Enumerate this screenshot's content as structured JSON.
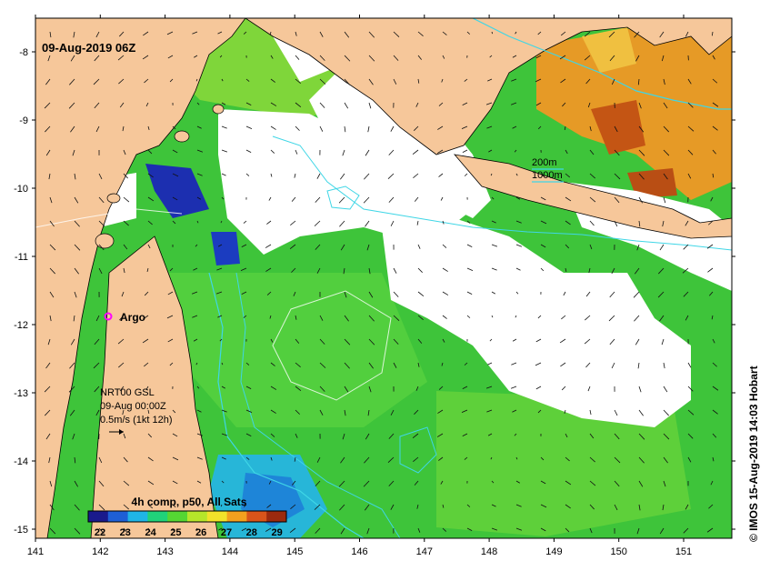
{
  "title": "09-Aug-2019 06Z",
  "argo_label": "Argo",
  "tide_gauge": {
    "line1": "NRT00 GSL",
    "line2": "09-Aug 00:00Z",
    "line3": "0.5m/s (1kt 12h)"
  },
  "isobaths": {
    "shallow": "200m",
    "deep": "1000m"
  },
  "colorbar": {
    "title": "4h comp, p50, All Sats",
    "ticks": [
      "22",
      "23",
      "24",
      "25",
      "26",
      "27",
      "28",
      "29"
    ],
    "colors": [
      "#1a1a8c",
      "#1e5fd6",
      "#1fb5e6",
      "#20d27a",
      "#55d633",
      "#b6e62a",
      "#f2e22a",
      "#f3a01e",
      "#d9541a",
      "#9c2a0e"
    ]
  },
  "credit": "© IMOS 15-Aug-2019 14:03 Hobart",
  "axes": {
    "x_ticks": [
      "141",
      "142",
      "143",
      "144",
      "145",
      "146",
      "147",
      "148",
      "149",
      "150",
      "151"
    ],
    "y_ticks": [
      "-8",
      "-9",
      "-10",
      "-11",
      "-12",
      "-13",
      "-14",
      "-15"
    ]
  },
  "colors": {
    "land": "#f6c79a",
    "isobath": "#3fd6e6",
    "argo": "#ff00ff",
    "cloud": "#ffffff"
  }
}
